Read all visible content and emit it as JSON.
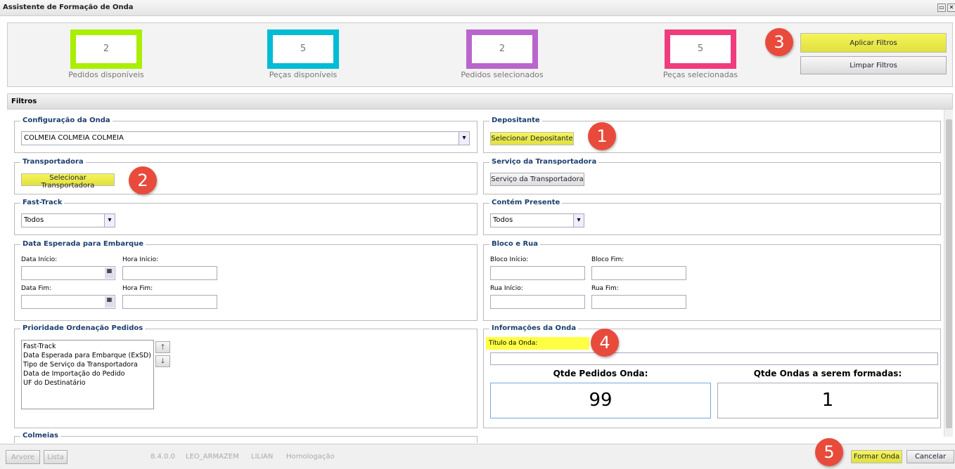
{
  "window": {
    "title": "Assistente de Formação de Onda",
    "restore_icon": "restore-icon",
    "close_icon": "close-icon"
  },
  "stats": [
    {
      "value": "2",
      "label": "Pedidos disponíveis",
      "color": "#aaee00"
    },
    {
      "value": "5",
      "label": "Peças disponíveis",
      "color": "#00bcd4"
    },
    {
      "value": "2",
      "label": "Pedidos selecionados",
      "color": "#b966cc"
    },
    {
      "value": "5",
      "label": "Peças selecionadas",
      "color": "#f03c7c"
    }
  ],
  "actions": {
    "apply": "Aplicar Filtros",
    "clear": "Limpar Filtros"
  },
  "badges": [
    "1",
    "2",
    "3",
    "4",
    "5"
  ],
  "filters": {
    "title": "Filtros",
    "config": {
      "legend": "Configuração da Onda",
      "value": "COLMEIA COLMEIA COLMEIA"
    },
    "depositante": {
      "legend": "Depositante",
      "button": "Selecionar Depositante"
    },
    "transportadora": {
      "legend": "Transportadora",
      "button": "Selecionar Transportadora"
    },
    "servico": {
      "legend": "Serviço da Transportadora",
      "button": "Serviço da Transportadora"
    },
    "fasttrack": {
      "legend": "Fast-Track",
      "value": "Todos"
    },
    "presente": {
      "legend": "Contém Presente",
      "value": "Todos"
    },
    "data": {
      "legend": "Data Esperada para Embarque",
      "data_inicio": "Data Início:",
      "hora_inicio": "Hora Início:",
      "data_fim": "Data Fim:",
      "hora_fim": "Hora Fim:"
    },
    "bloco": {
      "legend": "Bloco e Rua",
      "bloco_inicio": "Bloco Início:",
      "bloco_fim": "Bloco Fim:",
      "rua_inicio": "Rua Início:",
      "rua_fim": "Rua Fim:"
    },
    "prioridade": {
      "legend": "Prioridade Ordenação Pedidos",
      "items": [
        "Fast-Track",
        "Data Esperada para Embarque (ExSD)",
        "Tipo de Serviço da Transportadora",
        "Data de Importação do Pedido",
        "UF do Destinatário"
      ]
    },
    "info": {
      "legend": "Informações da Onda",
      "titulo_label": "Título da Onda:",
      "titulo_value": "",
      "qtde_pedidos_label": "Qtde Pedidos Onda:",
      "qtde_pedidos": "99",
      "qtde_ondas_label": "Qtde Ondas a serem formadas:",
      "qtde_ondas": "1"
    },
    "colmeias": {
      "legend": "Colmeias"
    }
  },
  "footer": {
    "arvore": "Arvore",
    "lista": "Lista",
    "version": "8.4.0.0",
    "armazem": "LEO_ARMAZEM",
    "user": "LILIAN",
    "env": "Homologação",
    "formar": "Formar Onda",
    "cancelar": "Cancelar"
  }
}
